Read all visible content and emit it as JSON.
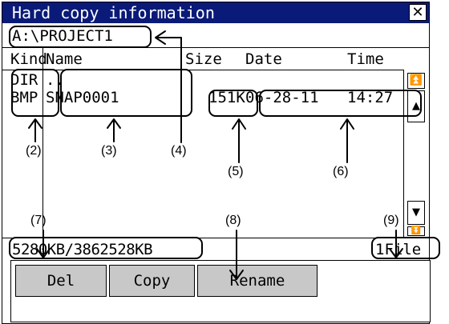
{
  "window": {
    "title": "Hard copy information",
    "close_icon": "close-icon",
    "path": "A:\\PROJECT1"
  },
  "columns": {
    "kind": "Kind",
    "name": "Name",
    "size": "Size",
    "date": "Date",
    "time": "Time"
  },
  "rows": [
    {
      "kind": "DIR",
      "name": "..",
      "size": "",
      "date": "",
      "time": ""
    },
    {
      "kind": "BMP",
      "name": "SNAP0001",
      "size": "151K",
      "date": "06-28-11",
      "time": "14:27"
    }
  ],
  "scrollbar": {
    "top_icon": "scroll-to-top-icon",
    "page_up_icon": "page-up-icon",
    "page_down_icon": "page-down-icon",
    "bottom_icon": "scroll-to-bottom-icon"
  },
  "status": {
    "storage": "5280KB/3862528KB",
    "file_count": "1File"
  },
  "buttons": {
    "delete": "Del",
    "copy": "Copy",
    "rename": "Rename"
  },
  "annotations": {
    "n2": "(2)",
    "n3": "(3)",
    "n4": "(4)",
    "n5": "(5)",
    "n6": "(6)",
    "n7": "(7)",
    "n8": "(8)",
    "n9": "(9)"
  },
  "colors": {
    "titlebar": "#0a1a78",
    "button_face": "#c8c8c8"
  }
}
